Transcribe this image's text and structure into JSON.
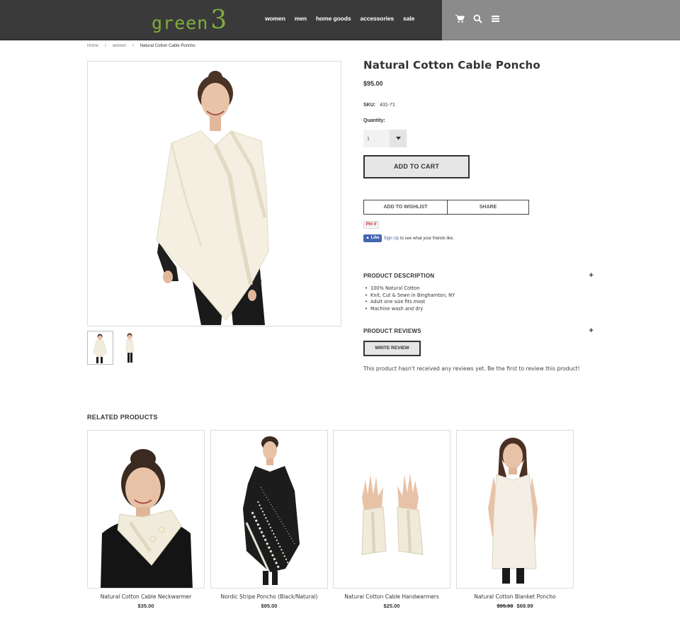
{
  "header": {
    "logo_word": "green",
    "logo_num": "3",
    "nav": [
      "women",
      "men",
      "home goods",
      "accessories",
      "sale"
    ],
    "icons": [
      "cart-icon",
      "search-icon",
      "menu-icon"
    ],
    "bg_left": "#3a3a3a",
    "bg_right": "#8b8b8b",
    "brand_color": "#7fae3e"
  },
  "breadcrumb": [
    "Home",
    "women",
    "Natural Cotton Cable Poncho"
  ],
  "product": {
    "title": "Natural Cotton Cable Poncho",
    "price": "$95.00",
    "sku_label": "SKU:",
    "sku": "431-71",
    "quantity_label": "Quantity:",
    "quantity": "1",
    "add_to_cart": "ADD TO CART",
    "wishlist": "ADD TO WISHLIST",
    "share": "SHARE",
    "pinit": "Pin it",
    "fb_like": "Like",
    "fb_signup": "Sign Up",
    "fb_text": "to see what your friends like.",
    "description_head": "PRODUCT DESCRIPTION",
    "description": [
      "100% Natural Cotton",
      "Knit, Cut & Sewn in Binghamton, NY",
      "Adult one size fits most",
      "Machine wash and dry"
    ],
    "reviews_head": "PRODUCT REVIEWS",
    "write_review": "WRITE REVIEW",
    "no_reviews": "This product hasn't received any reviews yet. Be the first to review this product!"
  },
  "related": {
    "title": "RELATED PRODUCTS",
    "items": [
      {
        "name": "Natural Cotton Cable Neckwarmer",
        "price": "$35.00",
        "old_price": ""
      },
      {
        "name": "Nordic Stripe Poncho (Black/Natural)",
        "price": "$95.00",
        "old_price": ""
      },
      {
        "name": "Natural Cotton Cable Handwarmers",
        "price": "$25.00",
        "old_price": ""
      },
      {
        "name": "Natural Cotton Blanket Poncho",
        "price": "$69.99",
        "old_price": "$95.00"
      }
    ]
  }
}
